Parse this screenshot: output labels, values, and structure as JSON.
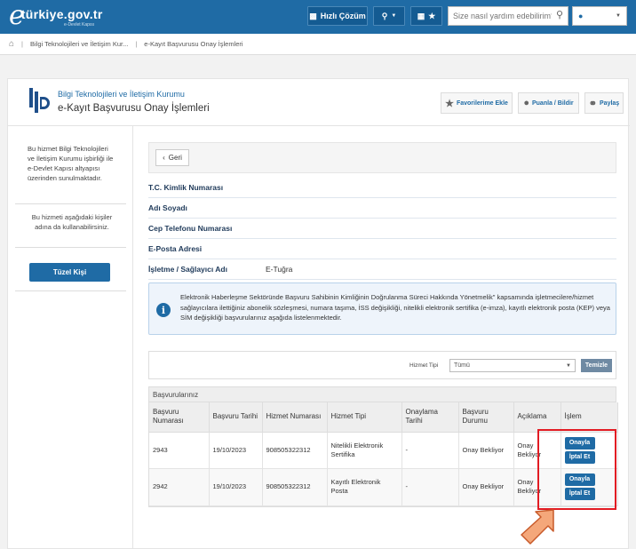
{
  "topbar": {
    "logo_text": "türkiye.gov.tr",
    "logo_sub": "e-Devlet Kapısı",
    "quick_label": "Hızlı Çözüm",
    "search_placeholder": "Size nasıl yardım edebilirim?",
    "accent": "#1f6ba5"
  },
  "breadcrumb": {
    "item1": "Bilgi Teknolojileri ve İletişim Kur...",
    "item2": "e-Kayıt Başvurusu Onay İşlemleri"
  },
  "header": {
    "institution": "Bilgi Teknolojileri ve İletişim Kurumu",
    "service": "e-Kayıt Başvurusu Onay İşlemleri",
    "fav_label": "Favorilerime Ekle",
    "rate_label": "Puanla / Bildir",
    "share_label": "Paylaş"
  },
  "sidebar": {
    "text1": "Bu hizmet Bilgi Teknolojileri ve İletişim Kurumu işbirliği ile e-Devlet Kapısı altyapısı üzerinden sunulmaktadır.",
    "text2": "Bu hizmeti aşağıdaki kişiler adına da kullanabilirsiniz.",
    "button": "Tüzel Kişi"
  },
  "back_label": "Geri",
  "fields": {
    "tc": "T.C. Kimlik Numarası",
    "name": "Adı Soyadı",
    "phone": "Cep Telefonu Numarası",
    "email": "E-Posta Adresi",
    "operator": "İşletme / Sağlayıcı Adı",
    "operator_value": "E-Tuğra"
  },
  "info": "Elektronik Haberleşme Sektöründe Başvuru Sahibinin Kimliğinin Doğrulanma Süreci Hakkında Yönetmelik\" kapsamında işletmecilere/hizmet sağlayıcılara ilettiğiniz abonelik sözleşmesi, numara taşıma, İSS değişikliği, nitelikli elektronik sertifika (e-imza), kayıtlı elektronik posta (KEP) veya SİM değişikliği başvurularınız aşağıda listelenmektedir.",
  "filter": {
    "label": "Hizmet Tipi",
    "selected": "Tümü",
    "clear": "Temizle"
  },
  "table": {
    "caption": "Başvurularınız",
    "headers": [
      "Başvuru Numarası",
      "Başvuru Tarihi",
      "Hizmet Numarası",
      "Hizmet Tipi",
      "Onaylama Tarihi",
      "Başvuru Durumu",
      "Açıklama",
      "İşlem"
    ],
    "rows": [
      {
        "no": "2943",
        "date": "19/10/2023",
        "service_no": "908505322312",
        "type": "Nitelikli Elektronik Sertifika",
        "approve_date": "-",
        "status": "Onay Bekliyor",
        "desc": "Onay Bekliyor"
      },
      {
        "no": "2942",
        "date": "19/10/2023",
        "service_no": "908505322312",
        "type": "Kayıtlı Elektronik Posta",
        "approve_date": "-",
        "status": "Onay Bekliyor",
        "desc": "Onay Bekliyor"
      }
    ],
    "approve_label": "Onayla",
    "cancel_label": "İptal Et"
  }
}
